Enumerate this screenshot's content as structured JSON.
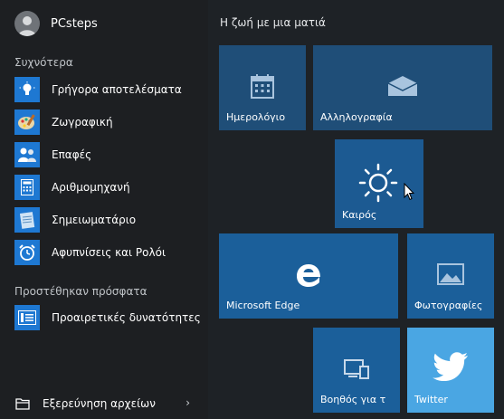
{
  "user": {
    "name": "PCsteps"
  },
  "left": {
    "frequent_label": "Συχνότερα",
    "frequent": [
      {
        "label": "Γρήγορα αποτελέσματα",
        "icon": "lightbulb-icon"
      },
      {
        "label": "Ζωγραφική",
        "icon": "paint-palette-icon"
      },
      {
        "label": "Επαφές",
        "icon": "people-icon"
      },
      {
        "label": "Αριθμομηχανή",
        "icon": "calculator-icon"
      },
      {
        "label": "Σημειωματάριο",
        "icon": "notepad-icon"
      },
      {
        "label": "Αφυπνίσεις και Ρολόι",
        "icon": "alarm-clock-icon"
      }
    ],
    "recent_label": "Προστέθηκαν πρόσφατα",
    "recent": [
      {
        "label": "Προαιρετικές δυνατότητες",
        "icon": "optional-features-icon"
      }
    ],
    "explorer": {
      "label": "Εξερεύνηση αρχείων",
      "icon": "folder-icon"
    }
  },
  "tiles": {
    "group_title": "Η ζωή με μια ματιά",
    "calendar": "Ημερολόγιο",
    "mail": "Αλληλογραφία",
    "weather": "Καιρός",
    "edge": "Microsoft Edge",
    "photos": "Φωτογραφίες",
    "help": "Βοηθός για τ",
    "twitter": "Twitter"
  },
  "colors": {
    "background": "#1d1f22",
    "tile_blue": "#1b5f9a",
    "tile_dark_blue": "#1f4e78",
    "twitter_tile": "#4aa6e3",
    "app_icon_blue": "#1e78d2"
  }
}
